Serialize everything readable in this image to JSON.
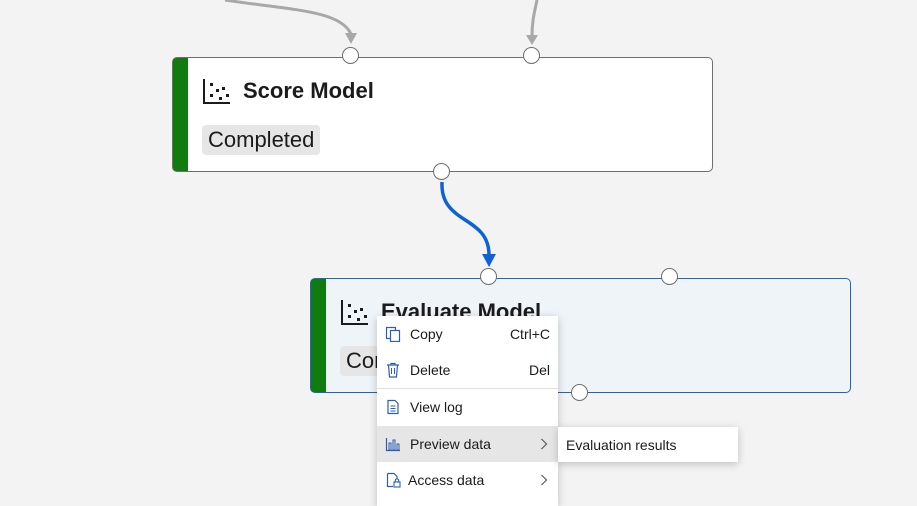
{
  "nodes": [
    {
      "title": "Score Model",
      "status": "Completed",
      "icon": "scatter-chart-icon"
    },
    {
      "title": "Evaluate Model",
      "status": "Completed",
      "icon": "scatter-chart-icon",
      "selected": true
    }
  ],
  "context_menu": {
    "items": [
      {
        "label": "Copy",
        "shortcut": "Ctrl+C",
        "icon": "copy-icon"
      },
      {
        "label": "Delete",
        "shortcut": "Del",
        "icon": "trash-icon"
      },
      {
        "label": "View log",
        "icon": "document-icon"
      },
      {
        "label": "Preview data",
        "icon": "bar-chart-icon",
        "has_submenu": true,
        "highlighted": true
      },
      {
        "label": "Access data",
        "icon": "file-lock-icon",
        "has_submenu": true
      }
    ],
    "submenu": {
      "items": [
        {
          "label": "Evaluation results"
        }
      ]
    }
  },
  "colors": {
    "completed": "#107c10",
    "selected_border": "#1a66c4",
    "link_active": "#0f62d6",
    "link_inactive": "#a8a8a8"
  }
}
